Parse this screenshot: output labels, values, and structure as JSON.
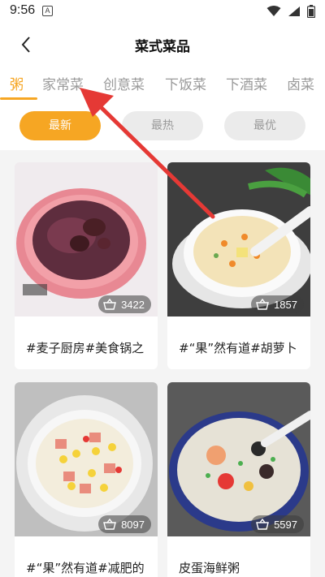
{
  "status_bar": {
    "time": "9:56",
    "notification_letter": "A"
  },
  "header": {
    "title": "菜式菜品"
  },
  "tabs": [
    {
      "label": "粥",
      "active": true
    },
    {
      "label": "家常菜",
      "active": false
    },
    {
      "label": "创意菜",
      "active": false
    },
    {
      "label": "下饭菜",
      "active": false
    },
    {
      "label": "下酒菜",
      "active": false
    },
    {
      "label": "卤菜",
      "active": false
    }
  ],
  "filters": [
    {
      "label": "最新",
      "active": true
    },
    {
      "label": "最热",
      "active": false
    },
    {
      "label": "最优",
      "active": false
    }
  ],
  "recipes": [
    {
      "caption": "#麦子厨房#美食锅之",
      "likes": "3422",
      "image": "red-bean-porridge"
    },
    {
      "caption": "#“果”然有道#胡萝卜",
      "likes": "1857",
      "image": "vegetable-congee"
    },
    {
      "caption": "#“果”然有道#减肥的",
      "likes": "8097",
      "image": "corn-ham-rice-soup"
    },
    {
      "caption": "皮蛋海鲜粥",
      "likes": "5597",
      "image": "seafood-congee"
    }
  ],
  "colors": {
    "accent": "#f6a623",
    "annotation_arrow": "#e53935"
  }
}
